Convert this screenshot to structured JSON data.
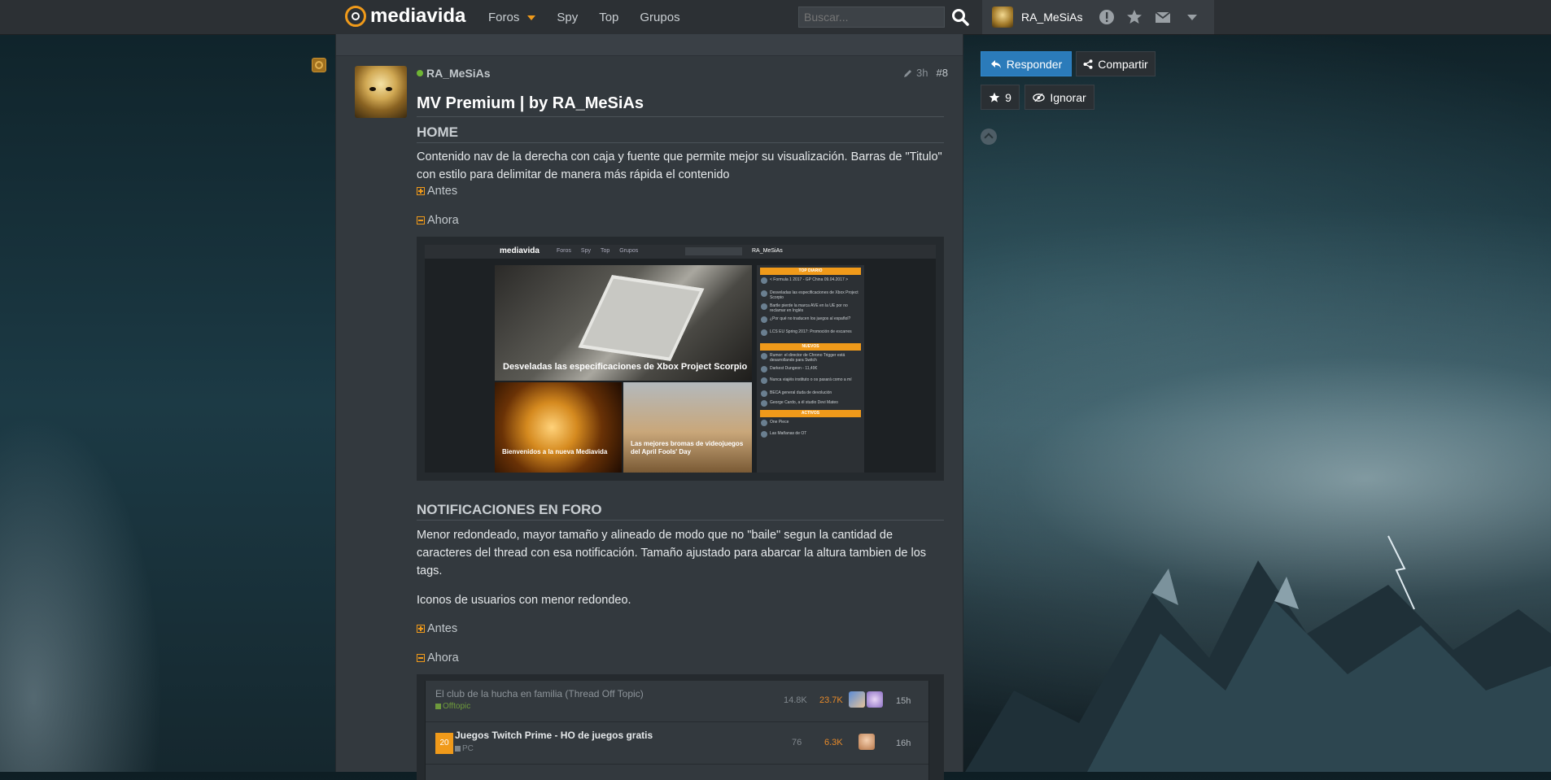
{
  "topbar": {
    "logo": "mediavida",
    "nav": [
      {
        "label": "Foros",
        "active": true
      },
      {
        "label": "Spy"
      },
      {
        "label": "Top"
      },
      {
        "label": "Grupos"
      }
    ],
    "search_placeholder": "Buscar...",
    "username": "RA_MeSiAs"
  },
  "post": {
    "author": "RA_MeSiAs",
    "time": "3h",
    "number": "#8",
    "title": "MV Premium | by RA_MeSiAs",
    "section1": {
      "heading": "HOME",
      "text": "Contenido nav de la derecha con caja y fuente que permite mejor su visualización. Barras de \"Titulo\" con estilo para delimitar de manera más rápida el contenido",
      "before": "Antes",
      "after": "Ahora"
    },
    "section2": {
      "heading": "NOTIFICACIONES EN FORO",
      "text1": "Menor redondeado, mayor tamaño y alineado de modo que no \"baile\" segun la cantidad de caracteres del thread con esa notificación. Tamaño ajustado para abarcar la altura tambien de los tags.",
      "text2": "Iconos de usuarios con menor redondeo.",
      "before": "Antes",
      "after": "Ahora"
    }
  },
  "screenshot1": {
    "logo": "mediavida",
    "nav": [
      "Foros",
      "Spy",
      "Top",
      "Grupos"
    ],
    "user": "RA_MeSiAs",
    "featured": "Desveladas las especificaciones de Xbox Project Scorpio",
    "tile1": "Bienvenidos a la nueva Mediavida",
    "tile2": "Las mejores bromas de videojuegos del April Fools' Day",
    "side": {
      "head1": "TOP DIARIO",
      "items1": [
        "< Formula 1 2017 - GP China 09.04.2017 >",
        "Desveladas las especificaciones de Xbox Project Scorpio",
        "Bartle pierde la marca AVE en la UE por no reclamar en Inglés",
        "¿Por qué no traducen los juegos al español?",
        "LCS EU Spring 2017: Promoción de escarres"
      ],
      "head2": "NUEVOS",
      "items2": [
        "Rumor: el director de Chrono Trigger está desarrollando para Switch",
        "Darkest Dungeon - 11,49€",
        "Nunca viajéis instituto o os pasará como a mí",
        "BECA general duda de devolución",
        "George Cardo, a él studio Devi Mateo"
      ],
      "head3": "ACTIVOS",
      "items3": [
        "One Piece",
        "Las Mañanas de OT"
      ]
    }
  },
  "screenshot2": {
    "rows": [
      {
        "title": "El club de la hucha en familia (Thread Off Topic)",
        "category": "Offtopic",
        "views": "14.8K",
        "replies": "23.7K",
        "time": "15h"
      },
      {
        "badge": "20",
        "title": "Juegos Twitch Prime - HO de juegos gratis",
        "category": "PC",
        "views": "76",
        "replies": "6.3K",
        "time": "16h"
      }
    ]
  },
  "sidebar": {
    "reply": "Responder",
    "share": "Compartir",
    "favorites_count": "9",
    "ignore": "Ignorar"
  },
  "colors": {
    "accent": "#f09a1a",
    "primary_button": "#2b7bba",
    "online": "#6fb534"
  }
}
